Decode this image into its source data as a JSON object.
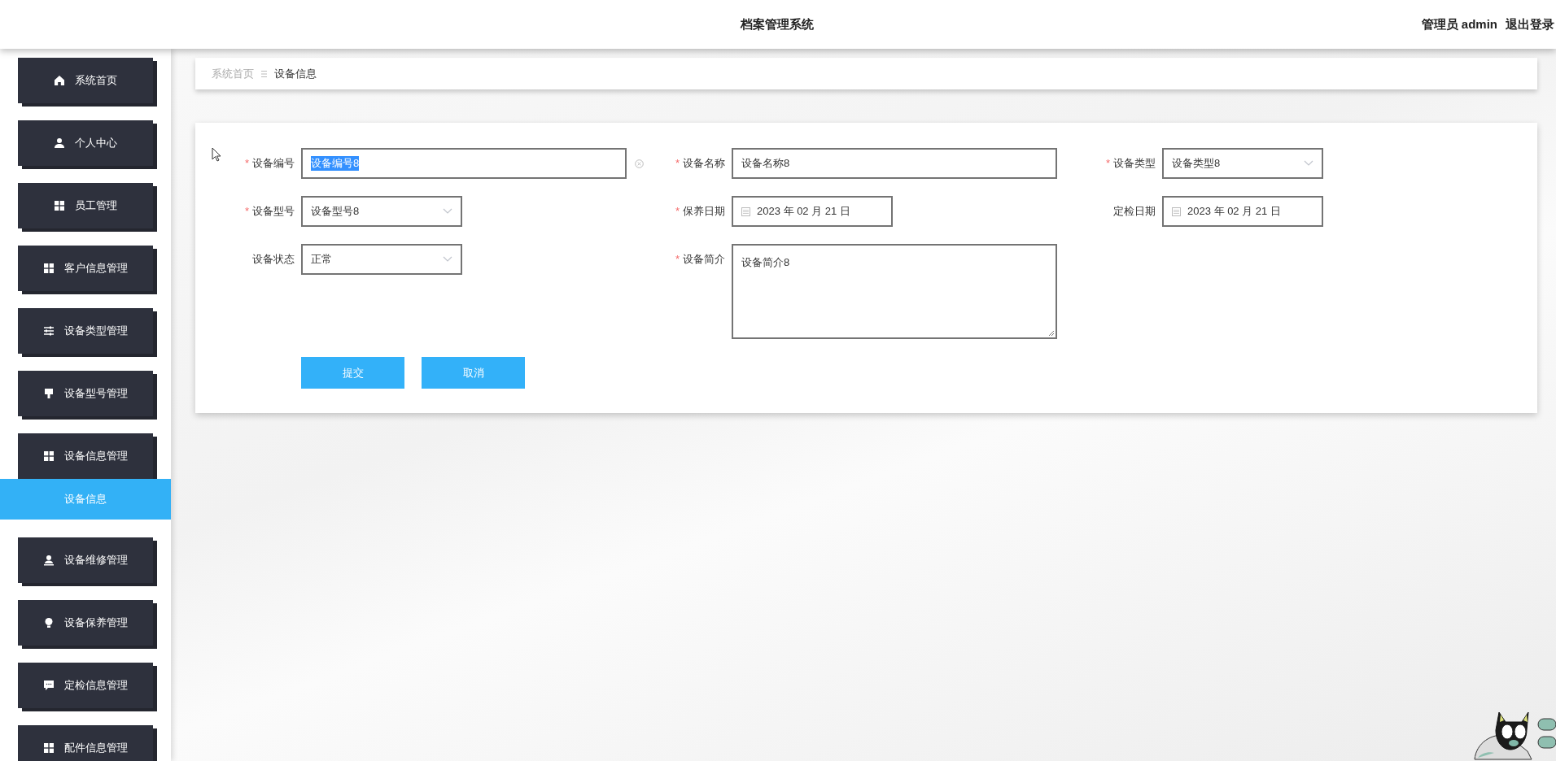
{
  "header": {
    "title": "档案管理系统",
    "user": "管理员 admin",
    "logout": "退出登录"
  },
  "sidebar": {
    "items": [
      {
        "label": "系统首页",
        "selected": false
      },
      {
        "label": "个人中心",
        "selected": false
      },
      {
        "label": "员工管理",
        "selected": false
      },
      {
        "label": "客户信息管理",
        "selected": false
      },
      {
        "label": "设备类型管理",
        "selected": false
      },
      {
        "label": "设备型号管理",
        "selected": false
      },
      {
        "label": "设备信息管理",
        "selected": false,
        "children": [
          {
            "label": "设备信息",
            "selected": true
          }
        ]
      },
      {
        "label": "设备维修管理",
        "selected": false
      },
      {
        "label": "设备保养管理",
        "selected": false
      },
      {
        "label": "定检信息管理",
        "selected": false
      },
      {
        "label": "配件信息管理",
        "selected": false
      }
    ]
  },
  "breadcrumb": [
    {
      "label": "系统首页",
      "current": false
    },
    {
      "label": "设备信息",
      "current": true
    }
  ],
  "form": {
    "fields": [
      {
        "kind": "text",
        "label": "设备编号",
        "required_mark": "*",
        "value": "设备编号8",
        "text_selected": true,
        "clearable": true
      },
      {
        "kind": "text",
        "label": "设备名称",
        "required_mark": "*",
        "value": "设备名称8",
        "text_selected": false,
        "clearable": false
      },
      {
        "kind": "select",
        "label": "设备类型",
        "required_mark": "*",
        "value": "设备类型8"
      },
      {
        "kind": "select",
        "label": "设备型号",
        "required_mark": "*",
        "value": "设备型号8"
      },
      {
        "kind": "date",
        "label": "保养日期",
        "required_mark": "*",
        "value": "2023 年 02 月 21 日"
      },
      {
        "kind": "date",
        "label": "定检日期",
        "value": "2023 年 02 月 21 日"
      },
      {
        "kind": "select",
        "label": "设备状态",
        "value": "正常"
      },
      {
        "kind": "textarea",
        "label": "设备简介",
        "required_mark": "*",
        "value": "设备简介8"
      }
    ],
    "buttons": [
      {
        "label": "提交"
      },
      {
        "label": "取消"
      }
    ]
  }
}
